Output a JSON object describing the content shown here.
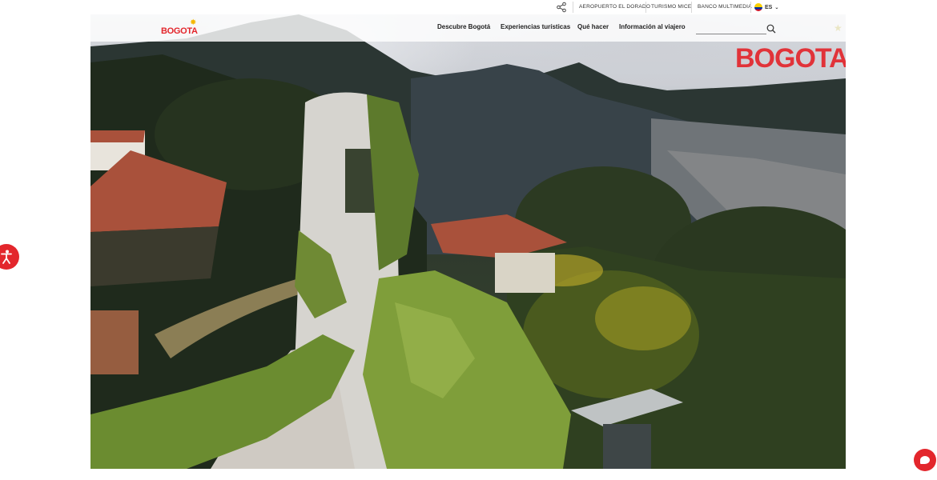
{
  "utility_bar": {
    "links": [
      {
        "label": "AEROPUERTO EL DORADO"
      },
      {
        "label": "TURISMO MICE"
      },
      {
        "label": "BANCO MULTIMEDIA"
      }
    ],
    "language": "ES",
    "share_icon": "share-icon"
  },
  "header": {
    "logo_text": "BOGOTA",
    "nav": [
      {
        "label": "Descubre Bogotá"
      },
      {
        "label": "Experiencias turísticas"
      },
      {
        "label": "Qué hacer"
      },
      {
        "label": "Información al viajero"
      }
    ],
    "search": {
      "placeholder": "",
      "icon": "search-icon"
    }
  },
  "hero": {
    "brand_text": "BOGOTA",
    "description_icon": "landscape-photo"
  },
  "colors": {
    "brand_red": "#e3262c",
    "brand_yellow": "#f5b800"
  },
  "floating": {
    "accessibility_icon": "accessibility-icon",
    "chat_icon": "chat-icon"
  }
}
